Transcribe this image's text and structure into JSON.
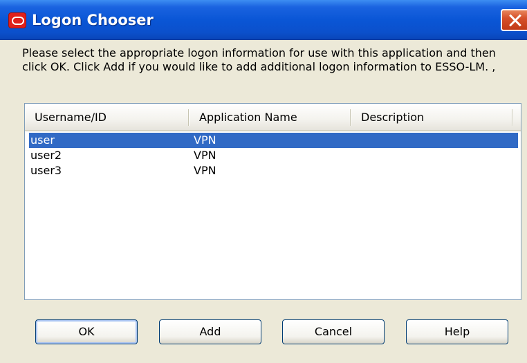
{
  "window": {
    "title": "Logon Chooser",
    "icon": "oracle-logo-icon"
  },
  "instructions": "Please select the appropriate logon information for use with this application and then click OK. Click Add if you would like to add additional logon information to ESSO-LM. ,",
  "list": {
    "columns": [
      "Username/ID",
      "Application Name",
      "Description"
    ],
    "rows": [
      {
        "username": "user",
        "application": "VPN",
        "description": "",
        "selected": true
      },
      {
        "username": "user2",
        "application": "VPN",
        "description": "",
        "selected": false
      },
      {
        "username": "user3",
        "application": "VPN",
        "description": "",
        "selected": false
      }
    ]
  },
  "buttons": {
    "ok": "OK",
    "add": "Add",
    "cancel": "Cancel",
    "help": "Help"
  },
  "colors": {
    "titlebar": "#0a56d6",
    "selection": "#316ac5",
    "close_button": "#d6502a"
  }
}
